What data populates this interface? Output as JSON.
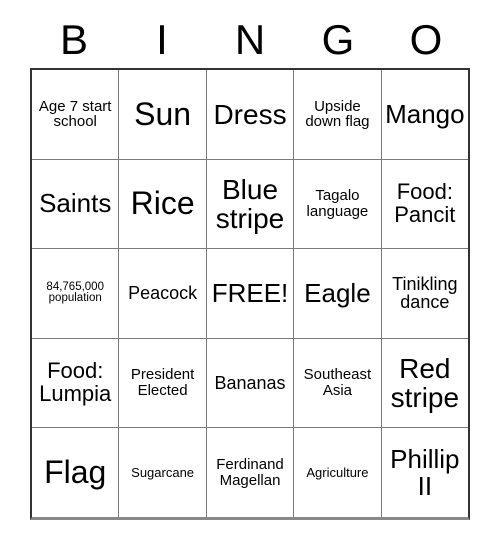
{
  "card": {
    "headers": [
      "B",
      "I",
      "N",
      "G",
      "O"
    ],
    "rows": [
      [
        {
          "text": "Age 7 start school",
          "size": "xs"
        },
        {
          "text": "Sun",
          "size": "xxl"
        },
        {
          "text": "Dress",
          "size": "xl"
        },
        {
          "text": "Upside down flag",
          "size": "xs"
        },
        {
          "text": "Mango",
          "size": "lg"
        }
      ],
      [
        {
          "text": "Saints",
          "size": "lg"
        },
        {
          "text": "Rice",
          "size": "xxl"
        },
        {
          "text": "Blue stripe",
          "size": "xl"
        },
        {
          "text": "Tagalo language",
          "size": "xs"
        },
        {
          "text": "Food: Pancit",
          "size": "md"
        }
      ],
      [
        {
          "text": "84,765,000 population",
          "size": "tiny"
        },
        {
          "text": "Peacock",
          "size": "sm"
        },
        {
          "text": "FREE!",
          "size": "lg"
        },
        {
          "text": "Eagle",
          "size": "lg"
        },
        {
          "text": "Tinikling dance",
          "size": "sm"
        }
      ],
      [
        {
          "text": "Food: Lumpia",
          "size": "md"
        },
        {
          "text": "President Elected",
          "size": "xs"
        },
        {
          "text": "Bananas",
          "size": "sm"
        },
        {
          "text": "Southeast Asia",
          "size": "xs"
        },
        {
          "text": "Red stripe",
          "size": "xl"
        }
      ],
      [
        {
          "text": "Flag",
          "size": "xxl"
        },
        {
          "text": "Sugarcane",
          "size": "xxs"
        },
        {
          "text": "Ferdinand Magellan",
          "size": "xs"
        },
        {
          "text": "Agriculture",
          "size": "xxs"
        },
        {
          "text": "Phillip II",
          "size": "lg"
        }
      ]
    ],
    "colors": {
      "background": "#ffffff",
      "text": "#000000",
      "grid_line": "#7a7a7a",
      "outer_border": "#333333"
    }
  }
}
